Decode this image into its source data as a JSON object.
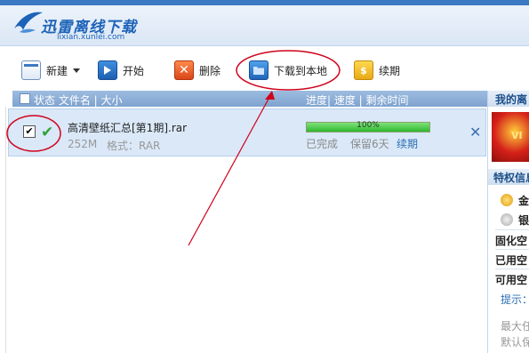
{
  "app": {
    "title": "迅雷离线下载",
    "url": "lixian.xunlei.com"
  },
  "toolbar": {
    "new_label": "新建",
    "start_label": "开始",
    "delete_label": "删除",
    "download_local_label": "下载到本地",
    "renew_label": "续期"
  },
  "list_header": {
    "left": "状态  文件名 | 大小",
    "right": "进度| 速度 | 剩余时间"
  },
  "tasks": [
    {
      "name": "高清壁纸汇总[第1期].rar",
      "size": "252M",
      "format": "格式：RAR",
      "progress_label": "100%",
      "progress_fraction": 1.0,
      "status": "已完成",
      "retention": "保留6天",
      "renew": "续期"
    }
  ],
  "right_panel": {
    "title": "我的离",
    "banner_text": "VI",
    "section_title": "特权信息",
    "gold_label": "金",
    "silver_label": "银",
    "fixed_label": "固化空",
    "used_label": "已用空",
    "avail_label": "可用空",
    "hint": "提示：",
    "max_text": "最大任",
    "default_text": "默认保"
  },
  "colors": {
    "brand_blue": "#1d63b8",
    "annotation_red": "#d0021b",
    "progress_green": "#2fb82f",
    "link_blue": "#2b6fb5"
  }
}
